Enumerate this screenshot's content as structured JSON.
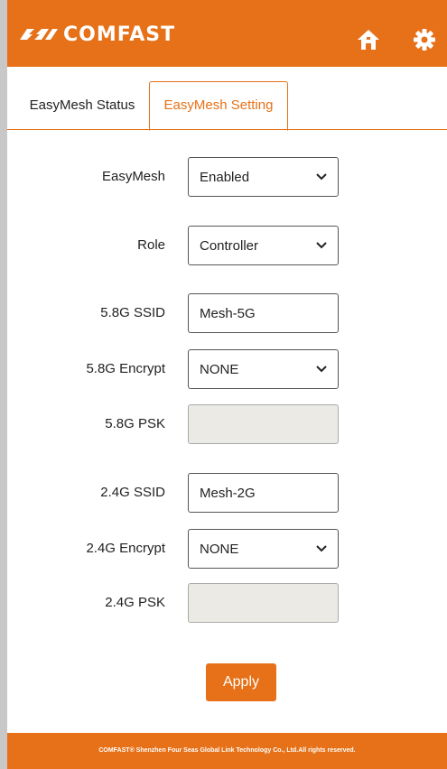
{
  "brand": {
    "name": "COMFAST",
    "color": "#e67118"
  },
  "header": {
    "home_icon": "home-icon",
    "settings_icon": "gear-icon"
  },
  "tabs": [
    {
      "label": "EasyMesh Status",
      "active": false
    },
    {
      "label": "EasyMesh Setting",
      "active": true
    }
  ],
  "form": {
    "easymesh": {
      "label": "EasyMesh",
      "value": "Enabled"
    },
    "role": {
      "label": "Role",
      "value": "Controller"
    },
    "ssid_5g": {
      "label": "5.8G SSID",
      "value": "Mesh-5G"
    },
    "encrypt_5g": {
      "label": "5.8G Encrypt",
      "value": "NONE"
    },
    "psk_5g": {
      "label": "5.8G PSK",
      "value": ""
    },
    "ssid_2g": {
      "label": "2.4G SSID",
      "value": "Mesh-2G"
    },
    "encrypt_2g": {
      "label": "2.4G Encrypt",
      "value": "NONE"
    },
    "psk_2g": {
      "label": "2.4G PSK",
      "value": ""
    }
  },
  "apply_label": "Apply",
  "footer": {
    "text": "COMFAST® Shenzhen Four Seas Global Link Technology Co., Ltd.All rights reserved."
  }
}
